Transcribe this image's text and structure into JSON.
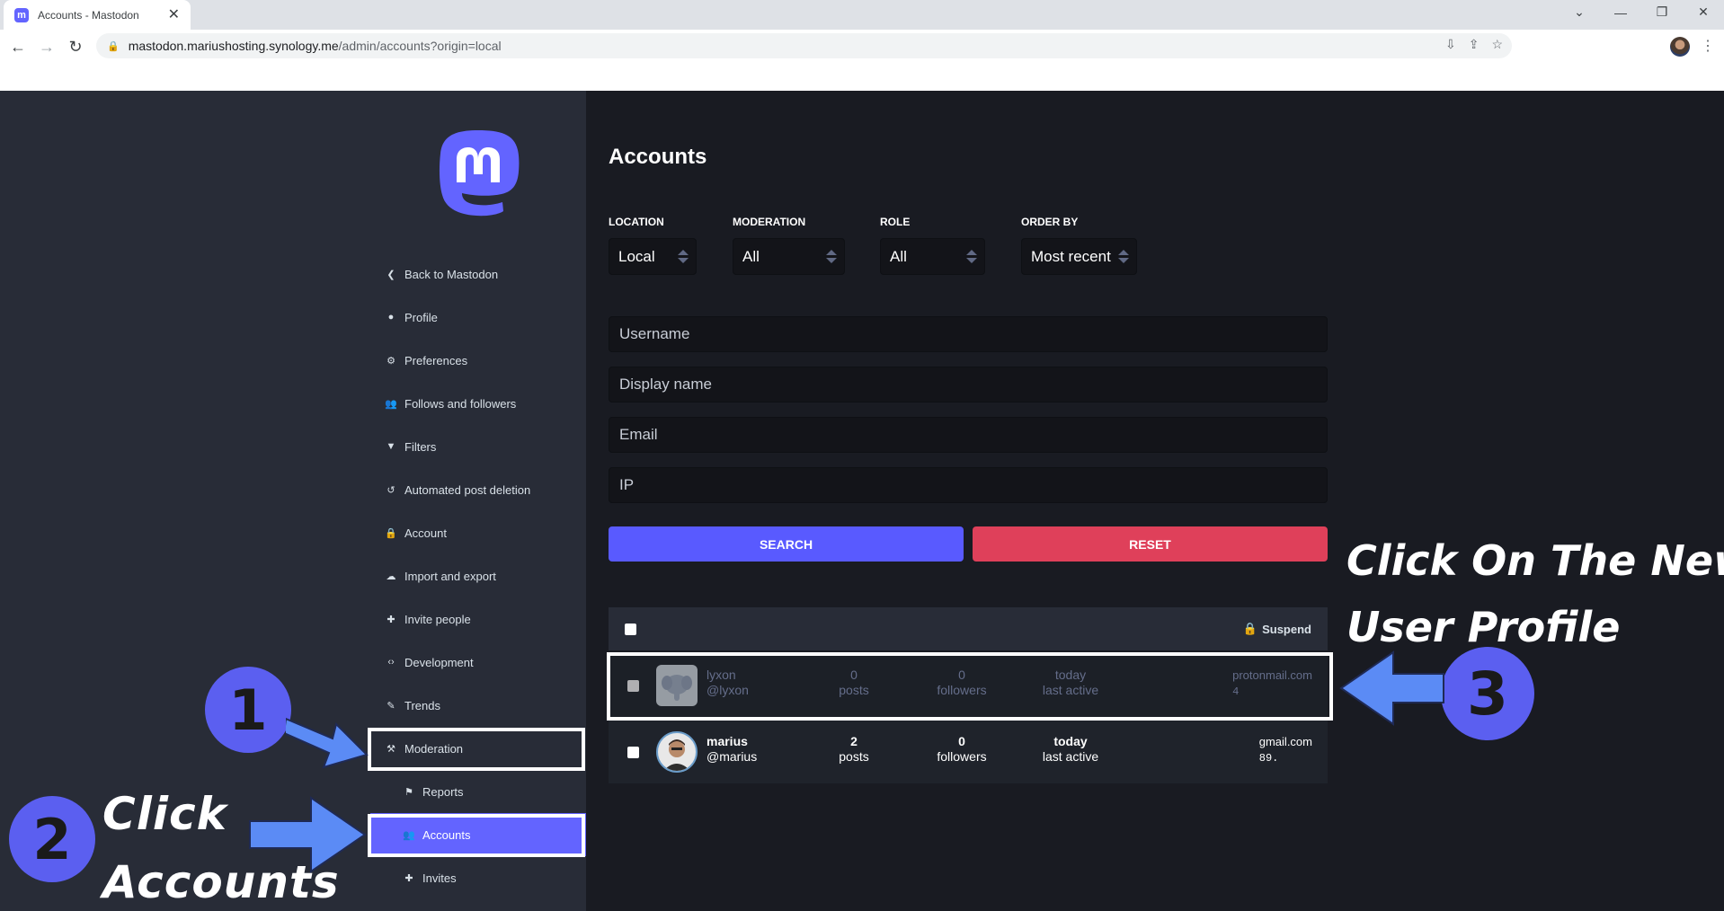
{
  "browser": {
    "tab_title": "Accounts - Mastodon",
    "tab_favicon": "m",
    "url_host": "mastodon.mariushosting.synology.me",
    "url_path": "/admin/accounts?origin=local"
  },
  "sidebar": {
    "items": [
      {
        "label": "Back to Mastodon",
        "icon": "chevron-left-icon"
      },
      {
        "label": "Profile",
        "icon": "user-icon"
      },
      {
        "label": "Preferences",
        "icon": "gear-icon"
      },
      {
        "label": "Follows and followers",
        "icon": "users-icon"
      },
      {
        "label": "Filters",
        "icon": "filter-icon"
      },
      {
        "label": "Automated post deletion",
        "icon": "history-icon"
      },
      {
        "label": "Account",
        "icon": "lock-icon"
      },
      {
        "label": "Import and export",
        "icon": "cloud-download-icon"
      },
      {
        "label": "Invite people",
        "icon": "user-plus-icon"
      },
      {
        "label": "Development",
        "icon": "code-icon"
      },
      {
        "label": "Trends",
        "icon": "fire-icon"
      },
      {
        "label": "Moderation",
        "icon": "gavel-icon"
      },
      {
        "label": "Reports",
        "icon": "flag-icon"
      },
      {
        "label": "Accounts",
        "icon": "users-icon"
      },
      {
        "label": "Invites",
        "icon": "user-plus-icon"
      }
    ]
  },
  "main": {
    "title": "Accounts",
    "filters": [
      {
        "label": "Location",
        "value": "Local"
      },
      {
        "label": "Moderation",
        "value": "All"
      },
      {
        "label": "Role",
        "value": "All"
      },
      {
        "label": "Order by",
        "value": "Most recent"
      }
    ],
    "inputs": {
      "username": "Username",
      "display_name": "Display name",
      "email": "Email",
      "ip": "IP"
    },
    "search_label": "Search",
    "reset_label": "Reset",
    "suspend_label": "Suspend",
    "accounts": [
      {
        "display_name": "lyxon",
        "handle": "@lyxon",
        "posts": "0",
        "posts_label": "posts",
        "followers": "0",
        "followers_label": "followers",
        "last_active": "today",
        "last_active_label": "last active",
        "email": "protonmail.com",
        "ip": "4"
      },
      {
        "display_name": "marius",
        "handle": "@marius",
        "posts": "2",
        "posts_label": "posts",
        "followers": "0",
        "followers_label": "followers",
        "last_active": "today",
        "last_active_label": "last active",
        "email": "gmail.com",
        "ip": "89."
      }
    ]
  },
  "annotations": {
    "step1": "1",
    "step2": "2",
    "step3": "3",
    "click_line1": "Click",
    "click_line2": "Accounts",
    "new_user_line1": "Click On The New",
    "new_user_line2": "User Profile"
  },
  "colors": {
    "accent": "#6364ff",
    "danger": "#df405a",
    "sidebar_bg": "#282c37",
    "main_bg": "#191b22"
  }
}
